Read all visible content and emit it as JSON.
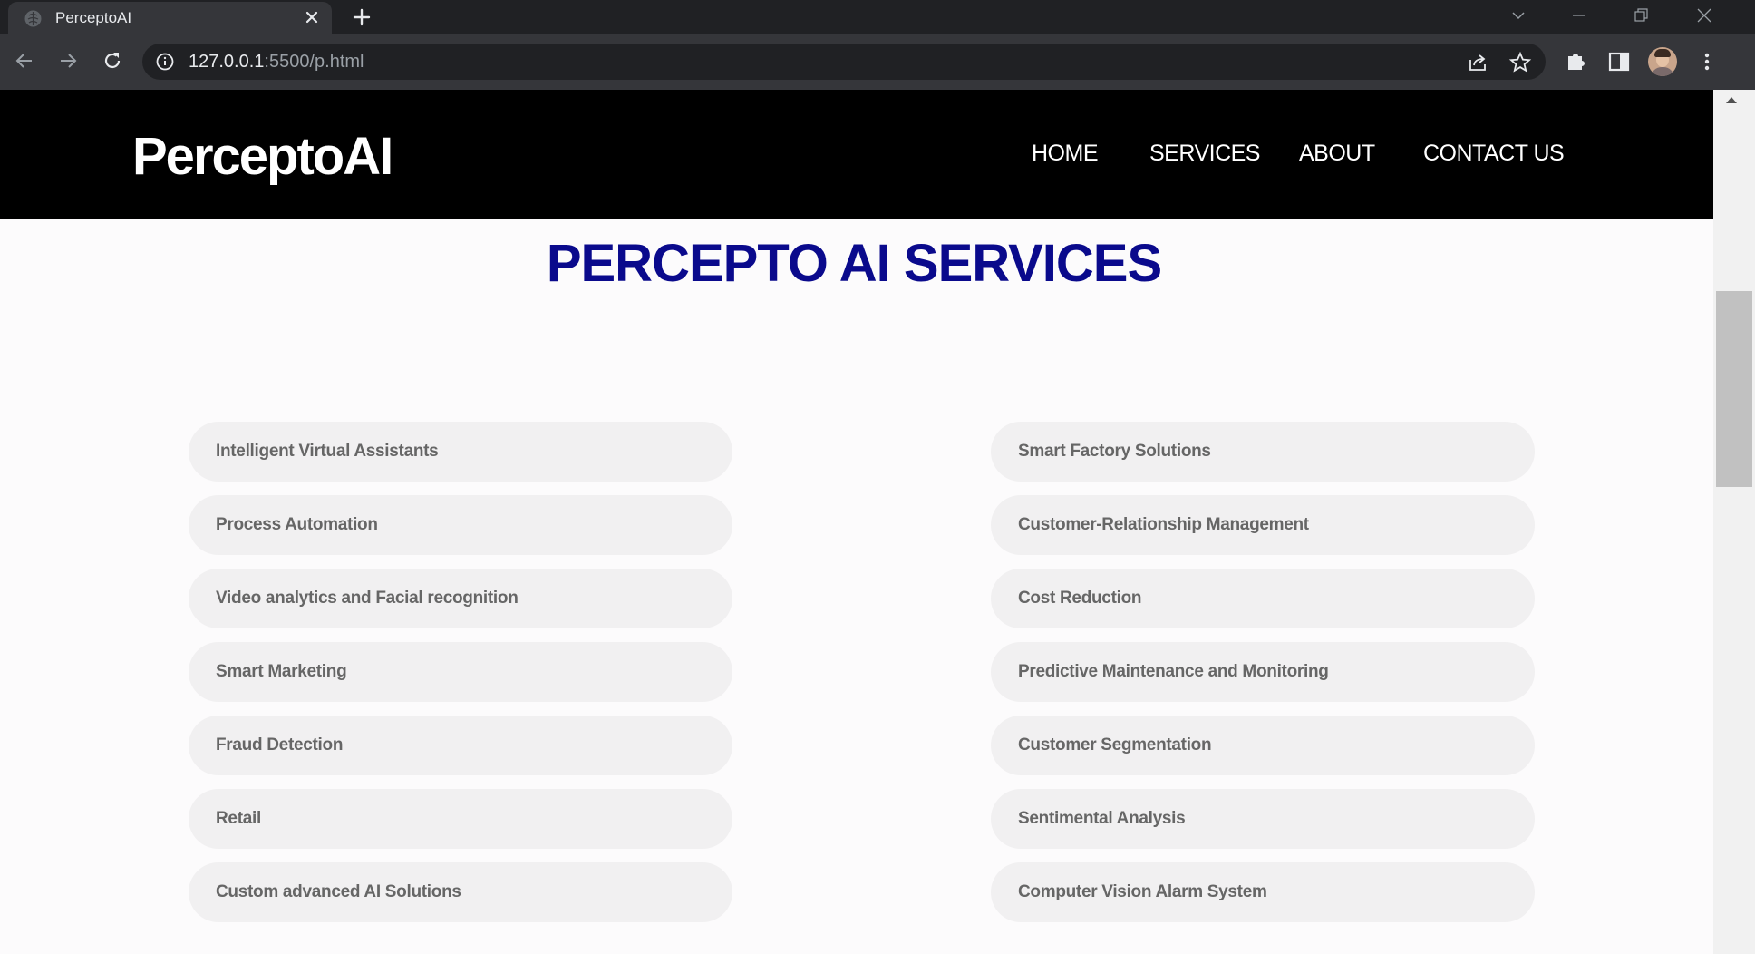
{
  "browser": {
    "tab_title": "PerceptoAI",
    "url_host": "127.0.0.1",
    "url_path": ":5500/p.html"
  },
  "header": {
    "logo": "PerceptoAI",
    "nav": [
      "HOME",
      "SERVICES",
      "ABOUT",
      "CONTACT US"
    ]
  },
  "main": {
    "title": "PERCEPTO AI SERVICES",
    "services_left": [
      "Intelligent Virtual Assistants",
      "Process Automation",
      "Video analytics and Facial recognition",
      "Smart Marketing",
      "Fraud Detection",
      "Retail",
      "Custom advanced AI Solutions"
    ],
    "services_right": [
      "Smart Factory Solutions",
      "Customer-Relationship Management",
      "Cost Reduction",
      "Predictive Maintenance and Monitoring",
      "Customer Segmentation",
      "Sentimental Analysis",
      "Computer Vision Alarm System"
    ]
  },
  "icons": {
    "favicon": "brain-icon",
    "close": "close-icon",
    "new_tab": "plus-icon",
    "back": "arrow-left-icon",
    "forward": "arrow-right-icon",
    "reload": "reload-icon",
    "info": "info-icon",
    "share": "share-icon",
    "bookmark": "star-icon",
    "extensions": "puzzle-icon",
    "side_panel": "side-panel-icon",
    "menu": "kebab-menu-icon"
  },
  "colors": {
    "header_bg": "#000000",
    "title": "#0a0a8c",
    "pill_bg": "#f1f0f1",
    "pill_text": "#666666"
  }
}
